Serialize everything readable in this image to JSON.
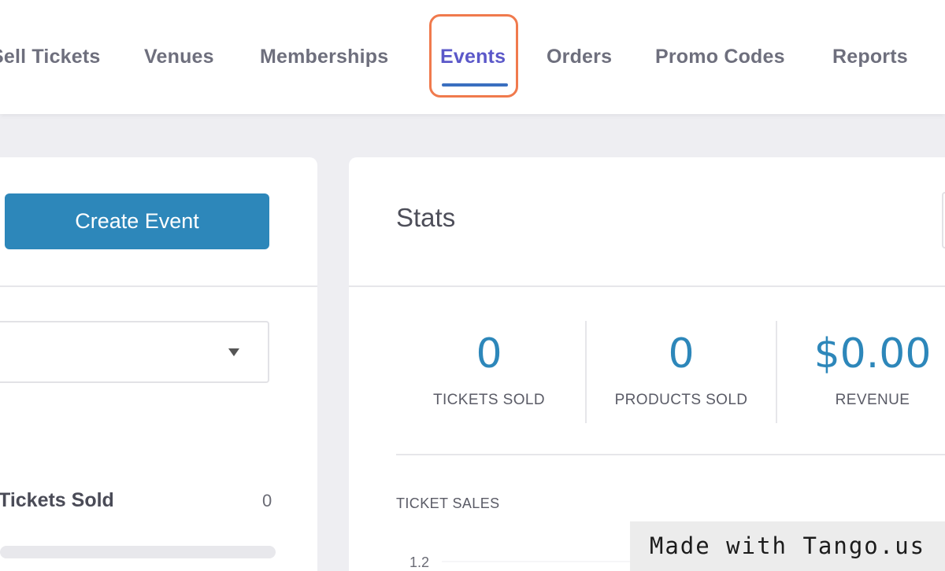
{
  "nav": {
    "items": [
      {
        "label": "Sell Tickets",
        "active": false
      },
      {
        "label": "Venues",
        "active": false
      },
      {
        "label": "Memberships",
        "active": false
      },
      {
        "label": "Events",
        "active": true
      },
      {
        "label": "Orders",
        "active": false
      },
      {
        "label": "Promo Codes",
        "active": false
      },
      {
        "label": "Reports",
        "active": false
      }
    ]
  },
  "left_panel": {
    "create_button_label": "Create Event",
    "select_value": "",
    "tickets_sold_label": "Tickets Sold",
    "tickets_sold_value": "0",
    "tickets_sold_progress": 0
  },
  "stats": {
    "title": "Stats",
    "items": [
      {
        "value": "0",
        "label": "TICKETS SOLD"
      },
      {
        "value": "0",
        "label": "PRODUCTS SOLD"
      },
      {
        "value": "$0.00",
        "label": "REVENUE"
      }
    ],
    "chart_title": "TICKET SALES",
    "chart_first_tick": "1.2"
  },
  "chart_data": {
    "type": "line",
    "title": "TICKET SALES",
    "y_ticks": [
      "1.2"
    ],
    "series": []
  },
  "colors": {
    "accent": "#2d87ba",
    "active_nav": "#5b58c9",
    "highlight": "#f07a4d"
  },
  "watermark": "Made with Tango.us"
}
